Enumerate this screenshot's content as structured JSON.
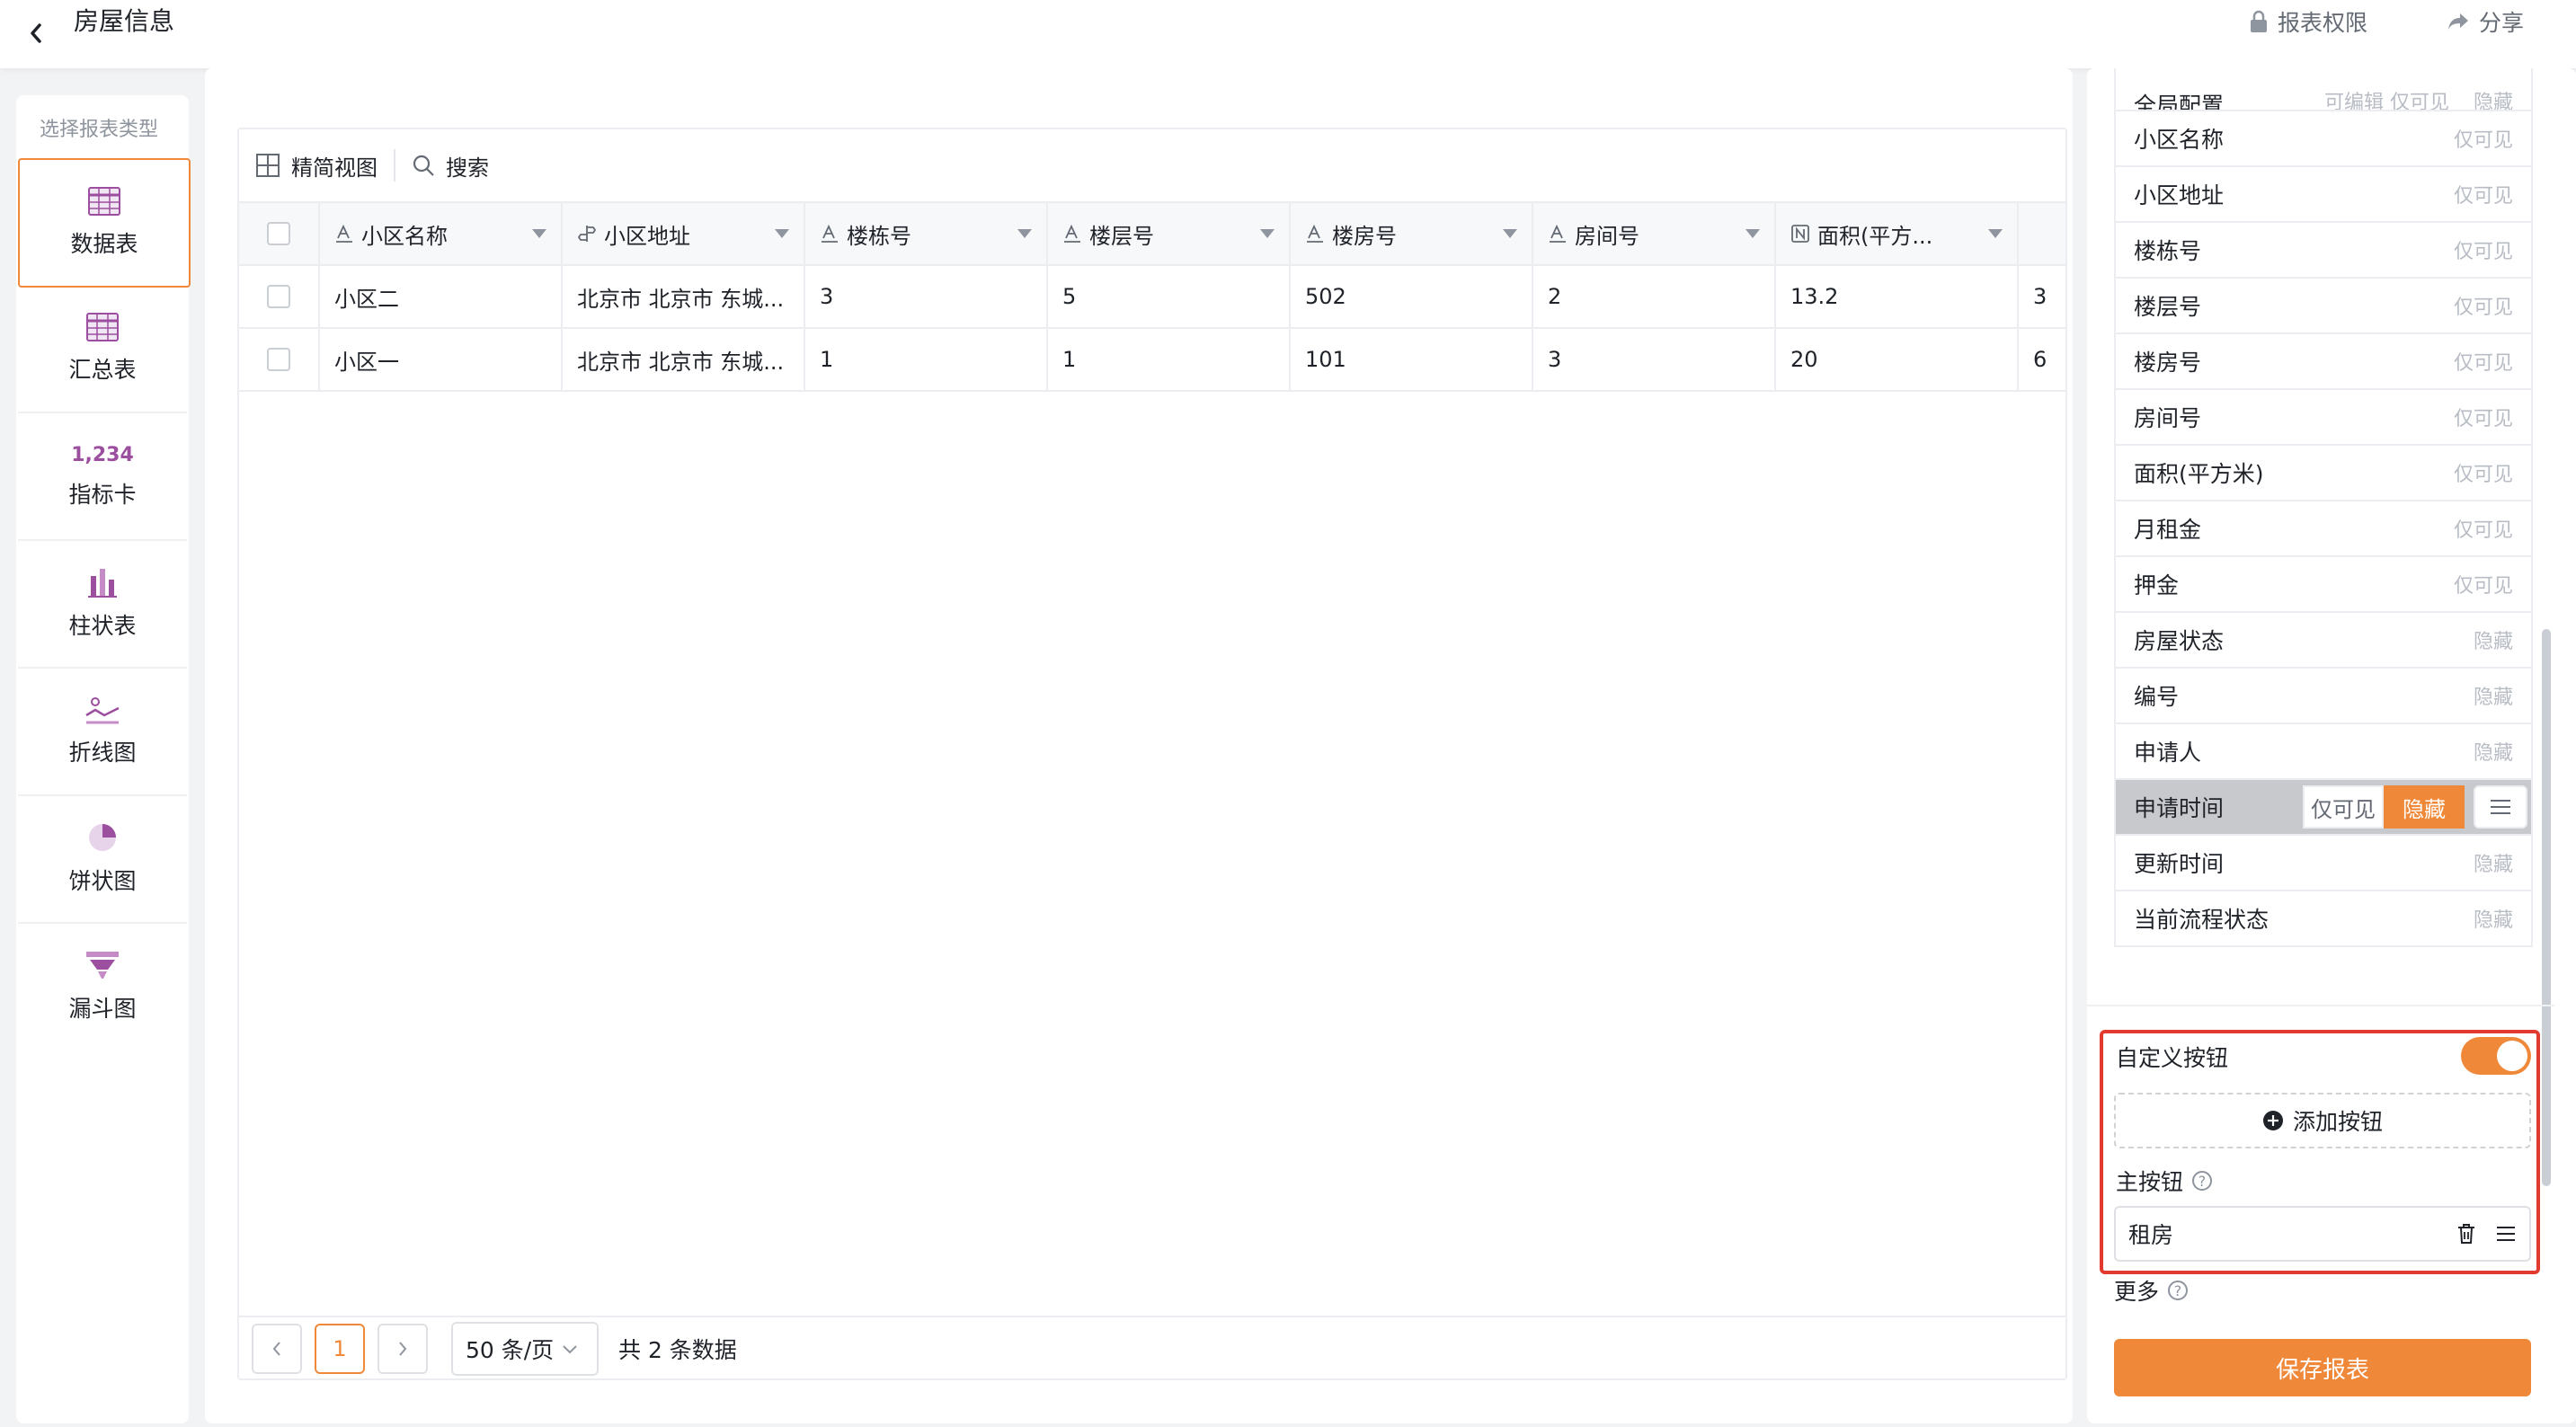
{
  "header": {
    "title": "房屋信息",
    "permission_label": "报表权限",
    "share_label": "分享"
  },
  "left_panel": {
    "title": "选择报表类型",
    "types": [
      {
        "label": "数据表",
        "icon": "table-icon"
      },
      {
        "label": "汇总表",
        "icon": "summary-table-icon"
      },
      {
        "label": "指标卡",
        "icon": "metric-card-icon",
        "icon_text": "1,234"
      },
      {
        "label": "柱状表",
        "icon": "bar-chart-icon"
      },
      {
        "label": "折线图",
        "icon": "line-chart-icon"
      },
      {
        "label": "饼状图",
        "icon": "pie-chart-icon"
      },
      {
        "label": "漏斗图",
        "icon": "funnel-chart-icon"
      }
    ],
    "active_index": 0
  },
  "table": {
    "toolbar": {
      "simple_view": "精简视图",
      "search": "搜索"
    },
    "columns": [
      {
        "label": "小区名称",
        "icon": "text-field-icon"
      },
      {
        "label": "小区地址",
        "icon": "location-field-icon"
      },
      {
        "label": "楼栋号",
        "icon": "text-field-icon"
      },
      {
        "label": "楼层号",
        "icon": "text-field-icon"
      },
      {
        "label": "楼房号",
        "icon": "text-field-icon"
      },
      {
        "label": "房间号",
        "icon": "text-field-icon"
      },
      {
        "label": "面积(平方...",
        "icon": "number-field-icon"
      }
    ],
    "rows": [
      [
        "小区二",
        "北京市 北京市 东城...",
        "3",
        "5",
        "502",
        "2",
        "13.2",
        "3"
      ],
      [
        "小区一",
        "北京市 北京市 东城...",
        "1",
        "1",
        "101",
        "3",
        "20",
        "6"
      ]
    ],
    "pagination": {
      "current": "1",
      "page_size": "50 条/页",
      "total": "共 2 条数据"
    }
  },
  "right_panel": {
    "partial_top": {
      "label": "全局配置",
      "options": [
        "可编辑",
        "仅可见",
        "隐藏"
      ]
    },
    "fields": [
      {
        "name": "小区名称",
        "perm": "仅可见"
      },
      {
        "name": "小区地址",
        "perm": "仅可见"
      },
      {
        "name": "楼栋号",
        "perm": "仅可见"
      },
      {
        "name": "楼层号",
        "perm": "仅可见"
      },
      {
        "name": "楼房号",
        "perm": "仅可见"
      },
      {
        "name": "房间号",
        "perm": "仅可见"
      },
      {
        "name": "面积(平方米)",
        "perm": "仅可见"
      },
      {
        "name": "月租金",
        "perm": "仅可见"
      },
      {
        "name": "押金",
        "perm": "仅可见"
      },
      {
        "name": "房屋状态",
        "perm": "隐藏"
      },
      {
        "name": "编号",
        "perm": "隐藏"
      },
      {
        "name": "申请人",
        "perm": "隐藏"
      }
    ],
    "highlighted_field": {
      "name": "申请时间",
      "option_visible": "仅可见",
      "option_hidden": "隐藏"
    },
    "fields_after": [
      {
        "name": "更新时间",
        "perm": "隐藏"
      },
      {
        "name": "当前流程状态",
        "perm": "隐藏"
      }
    ],
    "custom_button": {
      "title": "自定义按钮",
      "enabled": true,
      "add_label": "添加按钮",
      "main_label": "主按钮",
      "main_value": "租房"
    },
    "more_label": "更多",
    "save_label": "保存报表"
  },
  "colors": {
    "accent": "#f0883a",
    "highlight_border": "#e23a2e"
  }
}
